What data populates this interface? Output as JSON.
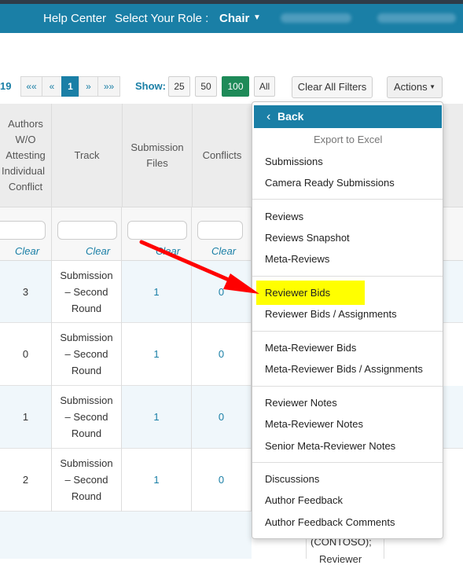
{
  "header": {
    "help_center": "Help Center",
    "select_role": "Select Your Role :",
    "role": "Chair"
  },
  "pager": {
    "count": "19",
    "first": "««",
    "prev": "«",
    "current": "1",
    "next": "»",
    "last": "»»"
  },
  "show": {
    "label": "Show:",
    "options": [
      "25",
      "50",
      "100",
      "All"
    ],
    "selected": "100"
  },
  "toolbar": {
    "clear_all": "Clear All Filters",
    "actions": "Actions"
  },
  "table": {
    "headers": [
      "Authors W/O Attesting Individual Conflict",
      "Track",
      "Submission Files",
      "Conflicts"
    ],
    "header_lines": {
      "authors": [
        "Authors",
        "W/O",
        "Attesting",
        "Individual",
        "Conflict"
      ],
      "track": [
        "Track"
      ],
      "files": [
        "Submission",
        "Files"
      ],
      "conflicts": [
        "Conflicts"
      ]
    },
    "clear_label": "Clear",
    "rows": [
      {
        "authors": "3",
        "track": "Submission – Second Round",
        "files": "1",
        "conflicts": "0"
      },
      {
        "authors": "0",
        "track": "Submission – Second Round",
        "files": "1",
        "conflicts": "0"
      },
      {
        "authors": "1",
        "track": "Submission – Second Round",
        "files": "1",
        "conflicts": "0"
      },
      {
        "authors": "2",
        "track": "Submission – Second Round",
        "files": "1",
        "conflicts": "0"
      }
    ],
    "track_lines": [
      "Submission",
      "– Second",
      "Round"
    ],
    "partial_text": [
      "(CONTOSO);",
      "Reviewer"
    ]
  },
  "menu": {
    "back": "Back",
    "export": "Export to Excel",
    "groups": [
      [
        "Submissions",
        "Camera Ready Submissions"
      ],
      [
        "Reviews",
        "Reviews Snapshot",
        "Meta-Reviews"
      ],
      [
        "Reviewer Bids",
        "Reviewer Bids / Assignments"
      ],
      [
        "Meta-Reviewer Bids",
        "Meta-Reviewer Bids / Assignments"
      ],
      [
        "Reviewer Notes",
        "Meta-Reviewer Notes",
        "Senior Meta-Reviewer Notes"
      ],
      [
        "Discussions",
        "Author Feedback",
        "Author Feedback Comments"
      ]
    ],
    "highlighted": "Reviewer Bids"
  },
  "colors": {
    "header_bg": "#1a7fa6",
    "highlight": "#ffff00",
    "arrow": "#ff0000",
    "active_show": "#1e8a58"
  },
  "icons": {
    "back": "chevron-left-icon",
    "dropdown": "caret-down-icon",
    "annotation": "red-arrow-icon"
  }
}
